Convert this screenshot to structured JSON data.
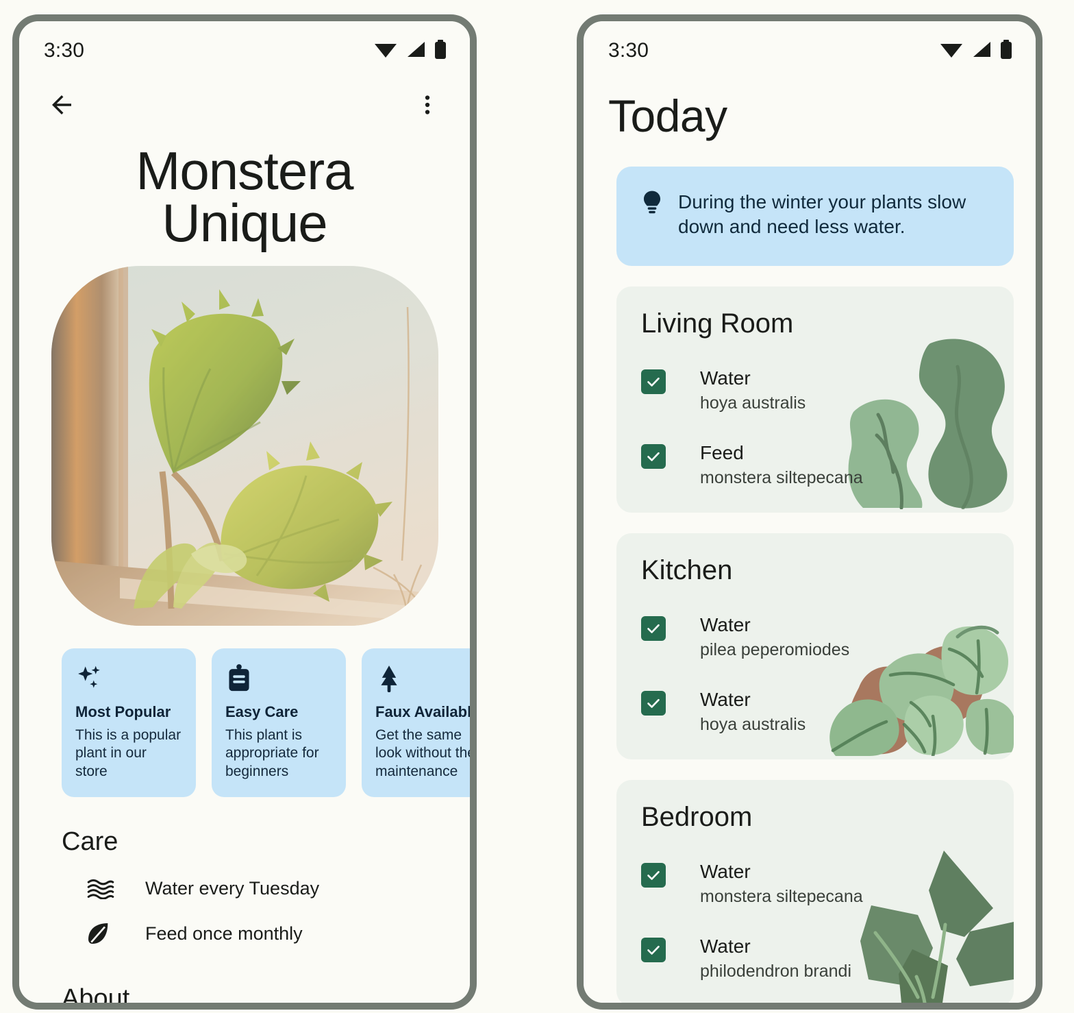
{
  "theme": {
    "page_bg": "#FBFBF5",
    "frame": "#737B73",
    "screen_bg": "#FBFBF6",
    "chip_blue": "#C5E4F8",
    "card_green": "#EDF2EC",
    "checkbox_green": "#256B4E",
    "text_primary": "#1A1C19"
  },
  "left_phone": {
    "status": {
      "time": "3:30",
      "icons": [
        "wifi-icon",
        "signal-icon",
        "battery-icon"
      ]
    },
    "appbar": {
      "back": "back-arrow-icon",
      "overflow": "more-vert-icon"
    },
    "title": "Monstera Unique",
    "hero_image_alt": "philodendron plant on a sunlit windowsill",
    "chips": [
      {
        "icon": "sparkles-icon",
        "title": "Most Popular",
        "body": "This is a popular plant in our store"
      },
      {
        "icon": "clipboard-icon",
        "title": "Easy Care",
        "body": "This plant is appropriate for beginners"
      },
      {
        "icon": "tree-icon",
        "title": "Faux Available",
        "body": "Get the same look without the maintenance"
      }
    ],
    "care": {
      "heading": "Care",
      "items": [
        {
          "icon": "water-waves-icon",
          "label": "Water every Tuesday"
        },
        {
          "icon": "leaf-icon",
          "label": "Feed once monthly"
        }
      ]
    },
    "about_heading": "About"
  },
  "right_phone": {
    "status": {
      "time": "3:30",
      "icons": [
        "wifi-icon",
        "signal-icon",
        "battery-icon"
      ]
    },
    "title": "Today",
    "tip": {
      "icon": "lightbulb-icon",
      "text": "During the winter your plants slow down and need less water."
    },
    "rooms": [
      {
        "name": "Living Room",
        "art": "kale-leaves-art",
        "tasks": [
          {
            "checked": true,
            "action": "Water",
            "plant": "hoya australis"
          },
          {
            "checked": true,
            "action": "Feed",
            "plant": "monstera siltepecana"
          }
        ]
      },
      {
        "name": "Kitchen",
        "art": "round-leaves-art",
        "tasks": [
          {
            "checked": true,
            "action": "Water",
            "plant": "pilea peperomiodes"
          },
          {
            "checked": true,
            "action": "Water",
            "plant": "hoya australis"
          }
        ]
      },
      {
        "name": "Bedroom",
        "art": "angular-leaves-art",
        "tasks": [
          {
            "checked": true,
            "action": "Water",
            "plant": "monstera siltepecana"
          },
          {
            "checked": true,
            "action": "Water",
            "plant": "philodendron brandi"
          }
        ]
      }
    ]
  }
}
